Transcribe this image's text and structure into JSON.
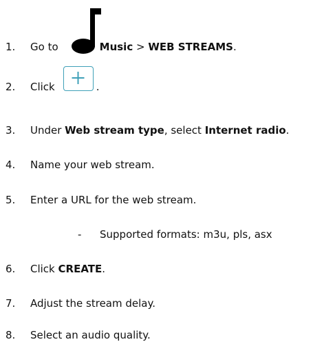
{
  "steps": [
    {
      "num": "1.",
      "parts": [
        "Go to",
        "Music",
        " > ",
        "WEB STREAMS",
        "."
      ],
      "icon": "music-note-icon"
    },
    {
      "num": "2.",
      "text": "Click",
      "button_icon": "plus-icon",
      "after": "."
    },
    {
      "num": "3.",
      "parts": [
        "Under ",
        "Web stream type",
        ", select ",
        "Internet radio",
        "."
      ]
    },
    {
      "num": "4.",
      "text": "Name your web stream."
    },
    {
      "num": "5.",
      "text": "Enter a URL for the web stream.",
      "sub": {
        "bullet": "-",
        "text": "Supported formats: m3u, pls, asx"
      }
    },
    {
      "num": "6.",
      "parts": [
        "Click ",
        "CREATE",
        "."
      ]
    },
    {
      "num": "7.",
      "text": "Adjust the stream delay."
    },
    {
      "num": "8.",
      "text": "Select an audio quality."
    }
  ],
  "colors": {
    "text": "#111111",
    "button_accent": "#3fa0b8"
  }
}
